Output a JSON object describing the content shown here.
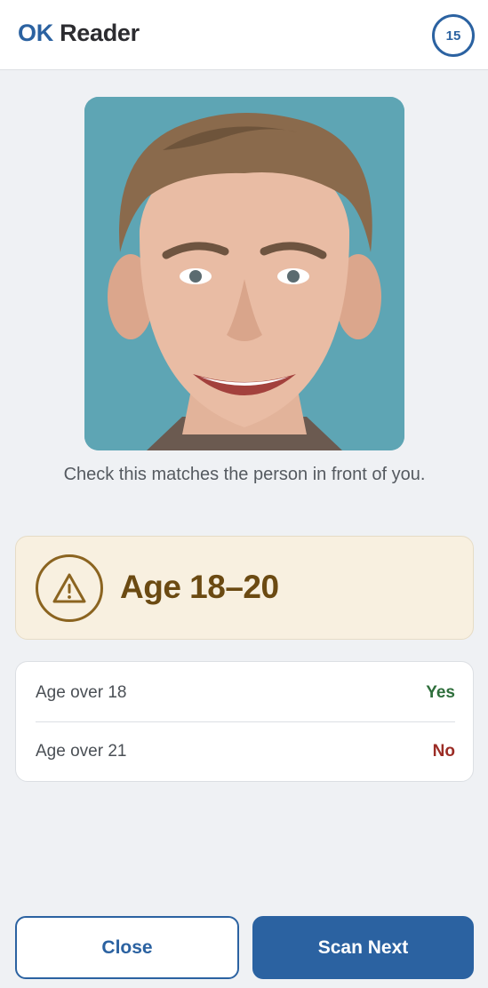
{
  "header": {
    "brand_ok": "OK",
    "brand_reader": "Reader",
    "count_badge": "15"
  },
  "photo": {
    "icon": "face-photo",
    "background_color": "#5ea5b4"
  },
  "hint": {
    "text": "Check this matches the person in front of you."
  },
  "age_card": {
    "icon": "warning-triangle-icon",
    "label": "Age 18–20",
    "accent_color": "#8b6420"
  },
  "checks": [
    {
      "label": "Age over 18",
      "value": "Yes",
      "status_color": "#2e6e3b"
    },
    {
      "label": "Age over 21",
      "value": "No",
      "status_color": "#9b2c25"
    }
  ],
  "actions": {
    "close_label": "Close",
    "scan_next_label": "Scan Next",
    "primary_color": "#2b62a1"
  }
}
